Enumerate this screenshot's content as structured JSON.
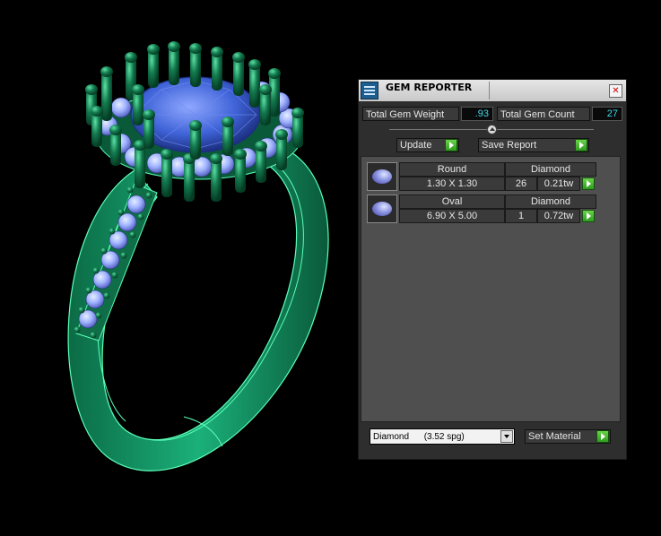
{
  "panel": {
    "title": "GEM REPORTER",
    "close_glyph": "✕",
    "icons": {
      "app": "gem-reporter-icon",
      "close": "close-icon",
      "play": "play-arrow-icon",
      "dropdown": "chevron-down-icon"
    }
  },
  "stats": {
    "total_weight_label": "Total Gem Weight",
    "total_weight_value": ".93",
    "total_count_label": "Total Gem Count",
    "total_count_value": "27"
  },
  "actions": {
    "update_label": "Update",
    "save_report_label": "Save Report"
  },
  "gems": [
    {
      "shape": "Round",
      "material": "Diamond",
      "size": "1.30 X 1.30",
      "count": "26",
      "weight": "0.21tw"
    },
    {
      "shape": "Oval",
      "material": "Diamond",
      "size": "6.90 X 5.00",
      "count": "1",
      "weight": "0.72tw"
    }
  ],
  "material": {
    "selected": "Diamond      (3.52 spg)",
    "set_material_label": "Set Material"
  },
  "colors": {
    "ring_metal": "#16a06a",
    "ring_edge": "#52ffb0",
    "center_stone": "#3f63d8",
    "accent_value": "#3fd8e8",
    "go_button": "#3fb52a"
  }
}
